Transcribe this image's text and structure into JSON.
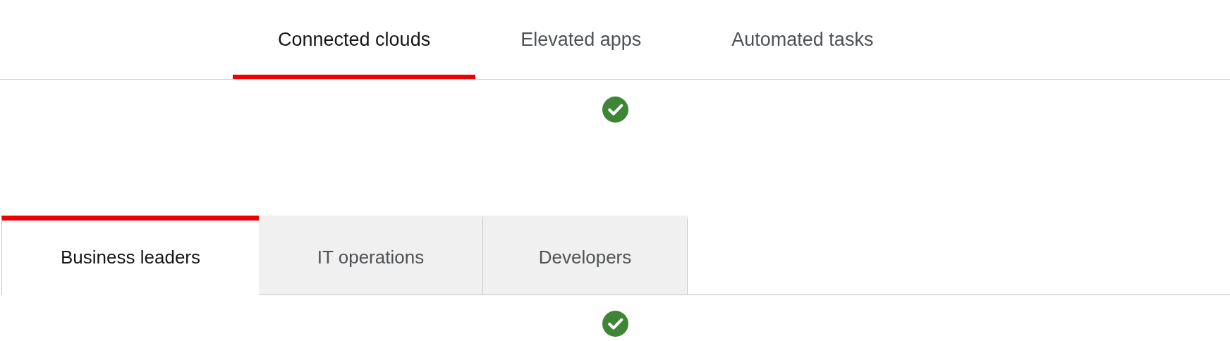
{
  "top_tabs": [
    {
      "label": "Connected clouds",
      "selected": true
    },
    {
      "label": "Elevated apps",
      "selected": false
    },
    {
      "label": "Automated tasks",
      "selected": false
    }
  ],
  "box_tabs": [
    {
      "label": "Business leaders",
      "selected": true
    },
    {
      "label": "IT operations",
      "selected": false
    },
    {
      "label": "Developers",
      "selected": false
    }
  ]
}
